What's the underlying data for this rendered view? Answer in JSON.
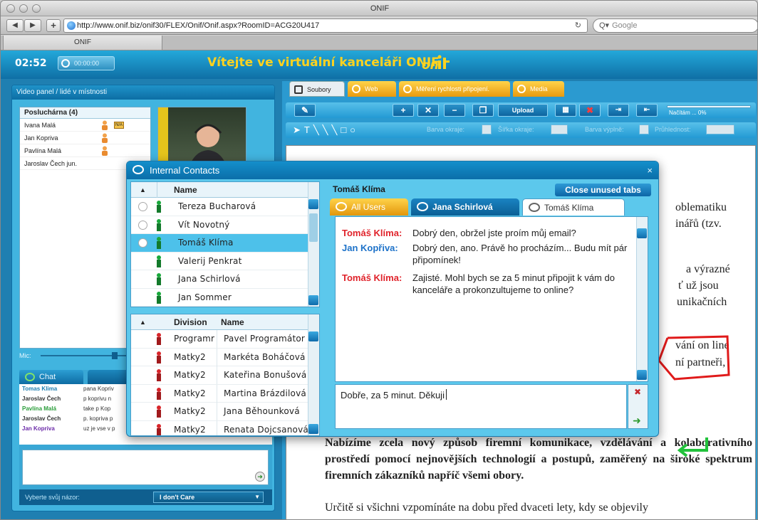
{
  "browser": {
    "window_title": "ONIF",
    "url": "http://www.onif.biz/onif30/FLEX/Onif/Onif.aspx?RoomID=ACG20U417",
    "search_placeholder": "Google",
    "tab_label": "ONIF"
  },
  "app": {
    "timer": "02:52",
    "recording_time": "00:00:00",
    "welcome": "Vítejte ve virtuální kanceláři ONIF",
    "logo": "onif",
    "colors": {
      "accent": "#1f7fb1",
      "title": "#ffd21f",
      "selected_row": "#4dc1ea",
      "sender_red": "#e0232b",
      "sender_blue": "#1d72c9"
    }
  },
  "left_panel": {
    "title": "Video panel / lidé v místnosti",
    "room_header": "Posluchárna (4)",
    "users": [
      "Ivana Malá",
      "Jan Kopriva",
      "Pavlína Malá",
      "Jaroslav Čech jun."
    ],
    "mic_label": "Mic:",
    "chat_tab": "Chat",
    "chat_log": [
      {
        "name": "Tomas Klima",
        "text": "pana Kopriv"
      },
      {
        "name": "Jaroslav Čech",
        "text": "p koprivu n"
      },
      {
        "name": "Pavlína Malá",
        "text": "take p Kop"
      },
      {
        "name": "Jaroslav Čech",
        "text": "p. kopriva p"
      },
      {
        "name": "Jan Kopriva",
        "text": "uz je vse v p"
      }
    ],
    "opinion_label": "Vyberte svůj názor:",
    "opinion_value": "I don't Care"
  },
  "right_panel": {
    "tabs": [
      "Soubory",
      "Web",
      "Měření rychlosti připojení.",
      "Media"
    ],
    "upload_label": "Upload",
    "loading_text": "Načítám ... 0%",
    "draw_labels": [
      "Barva okraje:",
      "Šířka okraje:",
      "Barva výplně:",
      "Průhlednost:"
    ],
    "doc_fragments": [
      "oblematiku",
      "inářů (tzv.",
      "a výrazné",
      "ť už jsou",
      "unikačních",
      "vání on line",
      "ní partneři,"
    ],
    "doc_paragraph": "Nabízíme zcela nový způsob firemní komunikace, vzdělávání a kolaborativního prostředí pomocí nejnovějších technologií a postupů, zaměřený na široké spektrum firemních zákazníků napříč všemi obory.",
    "doc_last_line": "Určitě si všichni vzpomínáte na dobu před dvaceti lety, kdy se objevily"
  },
  "dialog": {
    "title": "Internal Contacts",
    "contacts_header": "Name",
    "contacts": [
      "Tereza Bucharová",
      "Vít Novotný",
      "Tomáš Klíma",
      "Valerij Penkrat",
      "Jana Schirlová",
      "Jan Sommer"
    ],
    "division_headers": [
      "Division",
      "Name"
    ],
    "division_rows": [
      {
        "division": "Programr",
        "name": "Pavel Programátor"
      },
      {
        "division": "Matky2",
        "name": "Markéta Boháčová"
      },
      {
        "division": "Matky2",
        "name": "Kateřina Bonušová"
      },
      {
        "division": "Matky2",
        "name": "Martina Brázdilová"
      },
      {
        "division": "Matky2",
        "name": "Jana Běhounková"
      },
      {
        "division": "Matky2",
        "name": "Renata Dojcsanová"
      }
    ],
    "chat_title": "Tomáš Klíma",
    "close_unused_tabs": "Close unused tabs",
    "chat_tabs": [
      "All Users",
      "Jana Schirlová",
      "Tomáš Klíma"
    ],
    "messages": [
      {
        "sender": "Tomáš Klíma:",
        "text": "Dobrý den, obržel jste proím můj email?"
      },
      {
        "sender": "Jan Kopřiva:",
        "text": "Dobrý den, ano. Právě ho procházím... Budu mít pár připomínek!"
      },
      {
        "sender": "Tomáš Klíma:",
        "text": "Zajisté. Mohl bych se za 5 minut připojit k vám do kanceláře a prokonzultujeme to online?"
      }
    ],
    "input_value": "Dobře, za 5 minut. Děkuji"
  }
}
